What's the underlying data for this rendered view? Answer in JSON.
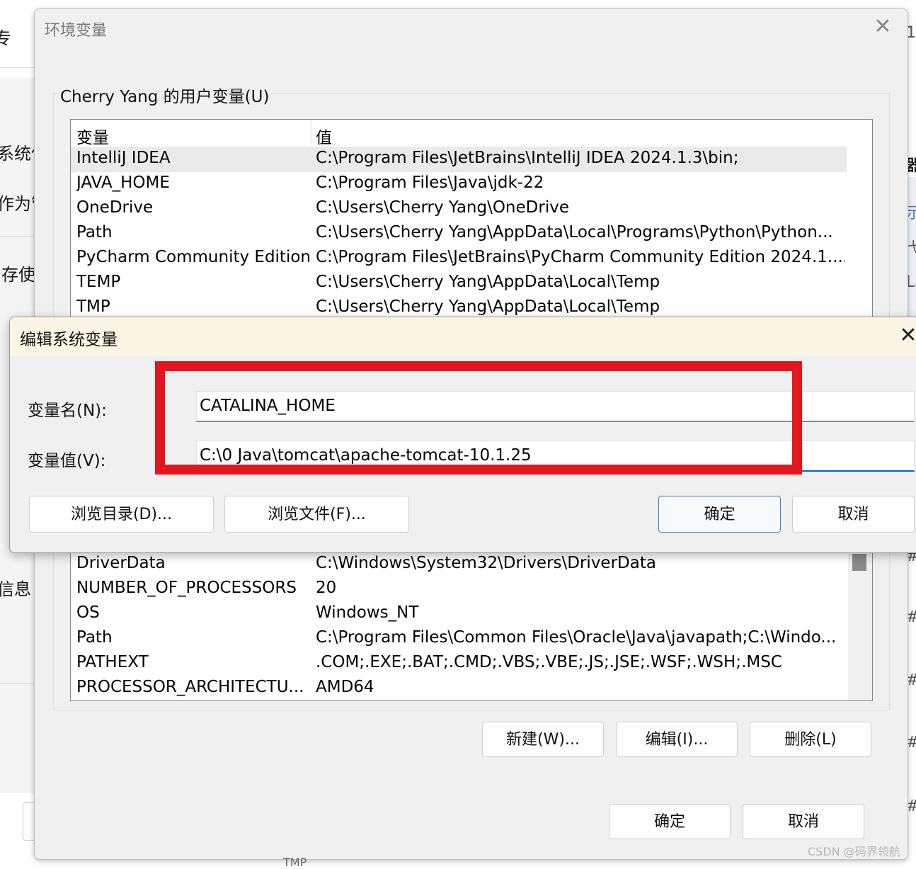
{
  "background_window": {
    "left_fragments": [
      "专",
      "系统保",
      "作为管",
      "存使",
      "信息"
    ],
    "right_fragments": [
      "1",
      "器",
      "示",
      "弋",
      "La",
      "#",
      "#",
      "#",
      "#",
      "#"
    ]
  },
  "env_dialog": {
    "title": "环境变量",
    "user_group_title": "Cherry Yang 的用户变量(U)",
    "user_list": {
      "columns": [
        "变量",
        "值"
      ],
      "rows": [
        {
          "name": "IntelliJ IDEA",
          "value": "C:\\Program Files\\JetBrains\\IntelliJ IDEA 2024.1.3\\bin;"
        },
        {
          "name": "JAVA_HOME",
          "value": "C:\\Program Files\\Java\\jdk-22"
        },
        {
          "name": "OneDrive",
          "value": "C:\\Users\\Cherry Yang\\OneDrive"
        },
        {
          "name": "Path",
          "value": "C:\\Users\\Cherry Yang\\AppData\\Local\\Programs\\Python\\Python..."
        },
        {
          "name": "PyCharm Community Edition",
          "value": "C:\\Program Files\\JetBrains\\PyCharm Community Edition 2024.1...."
        },
        {
          "name": "TEMP",
          "value": "C:\\Users\\Cherry Yang\\AppData\\Local\\Temp"
        },
        {
          "name": "TMP",
          "value": "C:\\Users\\Cherry Yang\\AppData\\Local\\Temp"
        }
      ]
    },
    "system_list": {
      "rows": [
        {
          "name": "DriverData",
          "value": "C:\\Windows\\System32\\Drivers\\DriverData"
        },
        {
          "name": "NUMBER_OF_PROCESSORS",
          "value": "20"
        },
        {
          "name": "OS",
          "value": "Windows_NT"
        },
        {
          "name": "Path",
          "value": "C:\\Program Files\\Common Files\\Oracle\\Java\\javapath;C:\\Windo..."
        },
        {
          "name": "PATHEXT",
          "value": ".COM;.EXE;.BAT;.CMD;.VBS;.VBE;.JS;.JSE;.WSF;.WSH;.MSC"
        },
        {
          "name": "PROCESSOR_ARCHITECTU...",
          "value": "AMD64"
        }
      ]
    },
    "system_buttons": {
      "new": "新建(W)...",
      "edit": "编辑(I)...",
      "delete": "删除(L)"
    },
    "footer_buttons": {
      "ok": "确定",
      "cancel": "取消"
    }
  },
  "edit_dialog": {
    "title": "编辑系统变量",
    "name_label": "变量名(N):",
    "name_value": "CATALINA_HOME",
    "value_label": "变量值(V):",
    "value_value": "C:\\0 Java\\tomcat\\apache-tomcat-10.1.25",
    "buttons": {
      "browse_dir": "浏览目录(D)...",
      "browse_file": "浏览文件(F)...",
      "ok": "确定",
      "cancel": "取消"
    }
  },
  "colors": {
    "highlight": "#e3161d",
    "focus_accent": "#0067c0"
  },
  "watermark": "CSDN @码界领航",
  "partial_text_below": "TMP"
}
